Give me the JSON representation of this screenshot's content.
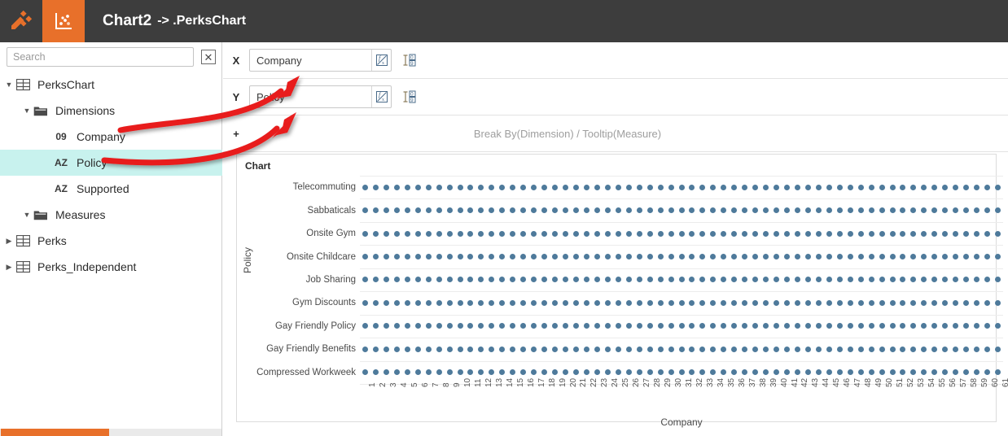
{
  "titlebar": {
    "app_icon": "tools-logo-icon",
    "tab_icon": "scatter-chart-icon",
    "title_main": "Chart2",
    "title_sub": "-> .PerksChart",
    "bg_color": "#3d3d3d",
    "accent_color": "#e8702a"
  },
  "sidebar": {
    "search": {
      "placeholder": "Search",
      "value": ""
    },
    "clear_label": "✕",
    "tree": [
      {
        "label": "PerksChart",
        "icon": "table-icon",
        "twisty": "▼",
        "indent": 4,
        "badge": "",
        "selected": false
      },
      {
        "label": "Dimensions",
        "icon": "folder-icon",
        "twisty": "▼",
        "indent": 26,
        "badge": "",
        "selected": false
      },
      {
        "label": "Company",
        "icon": "",
        "twisty": "",
        "indent": 50,
        "badge": "09",
        "selected": false
      },
      {
        "label": "Policy",
        "icon": "",
        "twisty": "",
        "indent": 50,
        "badge": "AZ",
        "selected": true
      },
      {
        "label": "Supported",
        "icon": "",
        "twisty": "",
        "indent": 50,
        "badge": "AZ",
        "selected": false
      },
      {
        "label": "Measures",
        "icon": "folder-icon",
        "twisty": "▼",
        "indent": 26,
        "badge": "",
        "selected": false
      },
      {
        "label": "Perks",
        "icon": "table-icon",
        "twisty": "▶",
        "indent": 4,
        "badge": "",
        "selected": false
      },
      {
        "label": "Perks_Independent",
        "icon": "table-icon",
        "twisty": "▶",
        "indent": 4,
        "badge": "",
        "selected": false
      }
    ],
    "scrollbar_color": "#e8702a"
  },
  "shelves": {
    "x": {
      "letter": "X",
      "value": "Company",
      "fx_icon": "function-fx-icon",
      "sort_icon": "sort-order-icon"
    },
    "y": {
      "letter": "Y",
      "value": "Policy",
      "fx_icon": "function-fx-icon",
      "sort_icon": "sort-order-icon"
    },
    "break": {
      "letter": "+",
      "placeholder": "Break By(Dimension) / Tooltip(Measure)"
    }
  },
  "chart_panel": {
    "caption": "Chart"
  },
  "chart_data": {
    "type": "scatter",
    "title": "Chart",
    "xlabel": "Company",
    "ylabel": "Policy",
    "grid": true,
    "legend": false,
    "point_color": "#4e7a9b",
    "categories_y": [
      "Telecommuting",
      "Sabbaticals",
      "Onsite Gym",
      "Onsite Childcare",
      "Job Sharing",
      "Gym Discounts",
      "Gay Friendly Policy",
      "Gay Friendly Benefits",
      "Compressed Workweek"
    ],
    "categories_x": [
      "1",
      "2",
      "3",
      "4",
      "5",
      "6",
      "7",
      "8",
      "9",
      "10",
      "11",
      "12",
      "13",
      "14",
      "15",
      "16",
      "17",
      "18",
      "19",
      "20",
      "21",
      "22",
      "23",
      "24",
      "25",
      "26",
      "27",
      "28",
      "29",
      "30",
      "31",
      "32",
      "33",
      "34",
      "35",
      "36",
      "37",
      "38",
      "39",
      "40",
      "41",
      "42",
      "43",
      "44",
      "45",
      "46",
      "47",
      "48",
      "49",
      "50",
      "51",
      "52",
      "53",
      "54",
      "55",
      "56",
      "57",
      "58",
      "59",
      "60",
      "61"
    ],
    "xlim": [
      1,
      61
    ],
    "note": "Every (x,y) combination of the 61 companies and 9 policies has a plotted point (full 61x9 grid of markers)."
  },
  "annotations": {
    "arrows": [
      {
        "name": "arrow-company-to-x",
        "color": "#e81c1c",
        "from_label": "Company",
        "to_shelf": "X"
      },
      {
        "name": "arrow-policy-to-y",
        "color": "#e81c1c",
        "from_label": "Policy",
        "to_shelf": "Y"
      }
    ]
  }
}
